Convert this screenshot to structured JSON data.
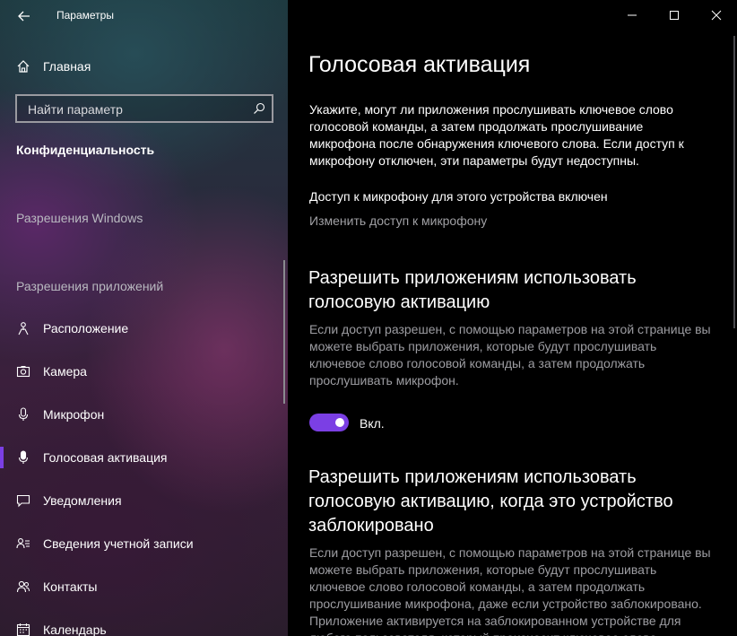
{
  "window": {
    "app_title": "Параметры"
  },
  "sidebar": {
    "home_label": "Главная",
    "search_placeholder": "Найти параметр",
    "section_heading": "Конфиденциальность",
    "group_windows": "Разрешения Windows",
    "group_apps": "Разрешения приложений",
    "items": [
      {
        "label": "Расположение",
        "icon": "location-icon"
      },
      {
        "label": "Камера",
        "icon": "camera-icon"
      },
      {
        "label": "Микрофон",
        "icon": "microphone-icon"
      },
      {
        "label": "Голосовая активация",
        "icon": "voice-activation-icon",
        "active": true
      },
      {
        "label": "Уведомления",
        "icon": "notifications-icon"
      },
      {
        "label": "Сведения учетной записи",
        "icon": "account-info-icon"
      },
      {
        "label": "Контакты",
        "icon": "contacts-icon"
      },
      {
        "label": "Календарь",
        "icon": "calendar-icon"
      }
    ]
  },
  "main": {
    "title": "Голосовая активация",
    "description": "Укажите, могут ли приложения прослушивать ключевое слово голосовой команды, а затем продолжать прослушивание микрофона после обнаружения ключевого слова. Если доступ к микрофону отключен, эти параметры будут недоступны.",
    "mic_status": "Доступ к микрофону для этого устройства включен",
    "mic_link": "Изменить доступ к микрофону",
    "section1": {
      "title": "Разрешить приложениям использовать голосовую активацию",
      "description": "Если доступ разрешен, с помощью параметров на этой странице вы можете выбрать приложения, которые будут прослушивать ключевое слово голосовой команды, а затем продолжать прослушивать микрофон.",
      "toggle_state": "Вкл.",
      "toggle_on": true
    },
    "section2": {
      "title": "Разрешить приложениям использовать голосовую активацию, когда это устройство заблокировано",
      "description": "Если доступ разрешен, с помощью параметров на этой странице вы можете выбрать приложения, которые будут прослушивать ключевое слово голосовой команды, а затем продолжать прослушивание микрофона, даже если устройство заблокировано. Приложение активируется на заблокированном устройстве для любого пользователя, который произносит ключевое слово."
    }
  },
  "colors": {
    "accent": "#7b3fe4",
    "secondary_text": "#9d9da2",
    "background": "#000000"
  }
}
